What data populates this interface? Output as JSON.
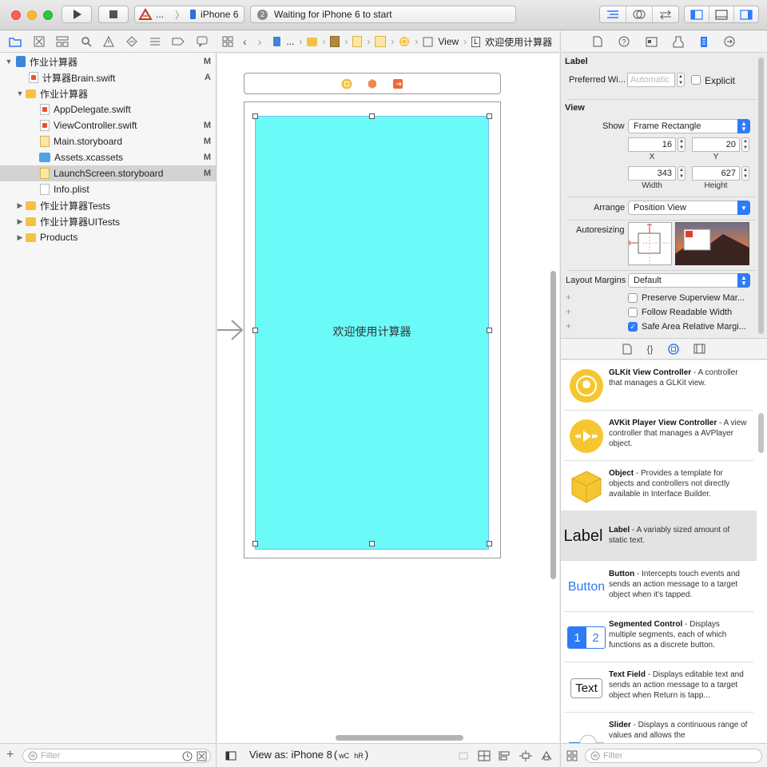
{
  "toolbar": {
    "scheme_label": "...",
    "device_label": "iPhone 6",
    "activity_badge": "2",
    "activity_text": "Waiting for iPhone 6 to start"
  },
  "navigator": {
    "filter_placeholder": "Filter",
    "items": [
      {
        "label": "作业计算器",
        "badge": "M"
      },
      {
        "label": "计算器Brain.swift",
        "badge": "A"
      },
      {
        "label": "作业计算器",
        "badge": ""
      },
      {
        "label": "AppDelegate.swift",
        "badge": ""
      },
      {
        "label": "ViewController.swift",
        "badge": "M"
      },
      {
        "label": "Main.storyboard",
        "badge": "M"
      },
      {
        "label": "Assets.xcassets",
        "badge": "M"
      },
      {
        "label": "LaunchScreen.storyboard",
        "badge": "M"
      },
      {
        "label": "Info.plist",
        "badge": ""
      },
      {
        "label": "作业计算器Tests",
        "badge": ""
      },
      {
        "label": "作业计算器UITests",
        "badge": ""
      },
      {
        "label": "Products",
        "badge": ""
      }
    ]
  },
  "jumpbar": {
    "crumb_dots": "...",
    "crumb_view": "View",
    "crumb_label": "欢迎使用计算器"
  },
  "canvas": {
    "label_text": "欢迎使用计算器",
    "view_color": "#6afaf8"
  },
  "editor_bottom": {
    "view_as": "View as: iPhone 8",
    "size_class_w": "wC",
    "size_class_h": "hR"
  },
  "inspector": {
    "label_section": "Label",
    "preferred_width_label": "Preferred Wi...",
    "preferred_width_placeholder": "Automatic",
    "explicit_label": "Explicit",
    "view_section": "View",
    "show_label": "Show",
    "show_value": "Frame Rectangle",
    "x_value": "16",
    "y_value": "20",
    "x_caption": "X",
    "y_caption": "Y",
    "width_value": "343",
    "height_value": "627",
    "width_caption": "Width",
    "height_caption": "Height",
    "arrange_label": "Arrange",
    "arrange_value": "Position View",
    "autoresizing_label": "Autoresizing",
    "layout_margins_label": "Layout Margins",
    "layout_margins_value": "Default",
    "preserve_label": "Preserve Superview Mar...",
    "readable_label": "Follow Readable Width",
    "safe_area_label": "Safe Area Relative Margi..."
  },
  "library": {
    "filter_placeholder": "Filter",
    "items": [
      {
        "title": "GLKit View Controller",
        "desc": " - A controller that manages a GLKit view."
      },
      {
        "title": "AVKit Player View Controller",
        "desc": " - A view controller that manages a AVPlayer object."
      },
      {
        "title": "Object",
        "desc": " - Provides a template for objects and controllers not directly available in Interface Builder."
      },
      {
        "title": "Label",
        "desc": " - A variably sized amount of static text.",
        "icon_text": "Label"
      },
      {
        "title": "Button",
        "desc": " - Intercepts touch events and sends an action message to a target object when it's tapped.",
        "icon_text": "Button"
      },
      {
        "title": "Segmented Control",
        "desc": " - Displays multiple segments, each of which functions as a discrete button.",
        "seg1": "1",
        "seg2": "2"
      },
      {
        "title": "Text Field",
        "desc": " - Displays editable text and sends an action message to a target object when Return is tapp...",
        "icon_text": "Text"
      },
      {
        "title": "Slider",
        "desc": " - Displays a continuous range of values and allows the"
      }
    ]
  }
}
